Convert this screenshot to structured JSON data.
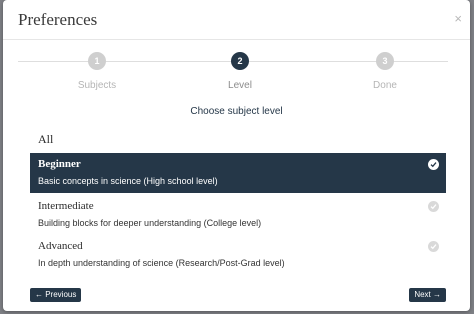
{
  "dialog": {
    "title": "Preferences",
    "close_glyph": "×"
  },
  "steps": [
    {
      "number": "1",
      "label": "Subjects",
      "active": false
    },
    {
      "number": "2",
      "label": "Level",
      "active": true
    },
    {
      "number": "3",
      "label": "Done",
      "active": false
    }
  ],
  "subtitle": "Choose subject level",
  "all_label": "All",
  "options": [
    {
      "name": "Beginner",
      "description": "Basic concepts in science (High school level)",
      "selected": true
    },
    {
      "name": "Intermediate",
      "description": "Building blocks for deeper understanding (College level)",
      "selected": false
    },
    {
      "name": "Advanced",
      "description": "In depth understanding of science (Research/Post-Grad level)",
      "selected": false
    }
  ],
  "buttons": {
    "previous": "← Previous",
    "next": "Next →"
  },
  "colors": {
    "accent": "#253748",
    "backdrop": "#7f8186",
    "inactive": "#cfcfcf"
  }
}
